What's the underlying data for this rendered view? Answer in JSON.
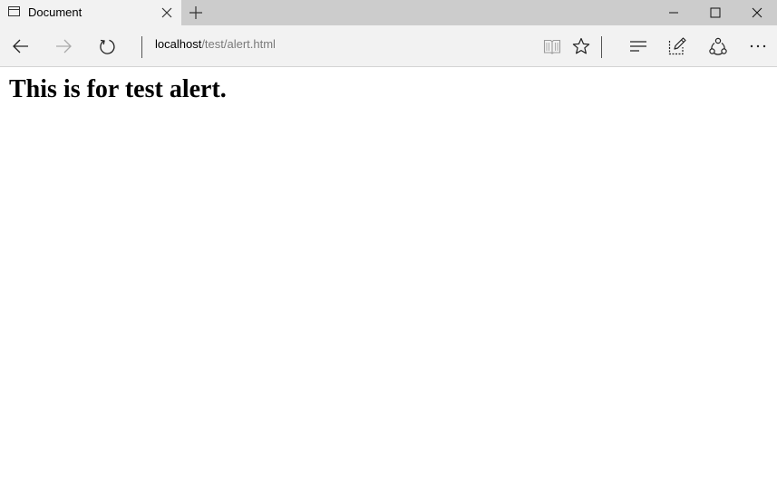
{
  "tab": {
    "title": "Document"
  },
  "address_bar": {
    "host": "localhost",
    "path": "/test/alert.html"
  },
  "page": {
    "heading": "This is for test alert."
  },
  "icons": {
    "tab": "page-icon",
    "close_tab": "close-icon",
    "new_tab": "plus-icon",
    "minimize": "minimize-icon",
    "maximize": "maximize-icon",
    "close_window": "close-icon",
    "back": "arrow-left-icon",
    "forward": "arrow-right-icon",
    "refresh": "refresh-icon",
    "reading_view": "book-icon",
    "favorites": "star-icon",
    "hub": "hub-icon",
    "web_note": "pen-icon",
    "share": "share-icon",
    "more": "ellipsis-icon"
  },
  "colors": {
    "tab_strip": "#cccccc",
    "toolbar": "#f2f2f2",
    "address_path": "#7a7a7a",
    "disabled_icon": "#aaaaaa"
  }
}
